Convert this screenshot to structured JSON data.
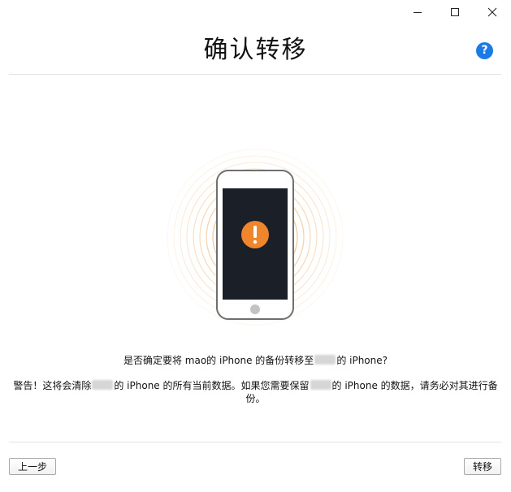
{
  "window": {
    "title": "确认转移",
    "help_label": "?"
  },
  "messages": {
    "confirm_prefix": "是否确定要将 mao的 iPhone 的备份转移至",
    "confirm_suffix": "的 iPhone?",
    "warning_prefix": "警告！这将会清除",
    "warning_mid": "的 iPhone 的所有当前数据。如果您需要保留",
    "warning_suffix": "的 iPhone 的数据，请务必对其进行备份。"
  },
  "buttons": {
    "back": "上一步",
    "transfer": "转移"
  },
  "colors": {
    "accent_blue": "#1a7be6",
    "alert_orange": "#f0862c",
    "ring_orange": "#f5c79a",
    "screen_dark": "#1b1f27"
  },
  "icons": {
    "minimize": "minimize-icon",
    "maximize": "maximize-icon",
    "close": "close-icon",
    "help": "help-icon",
    "alert": "exclamation-alert-icon"
  }
}
